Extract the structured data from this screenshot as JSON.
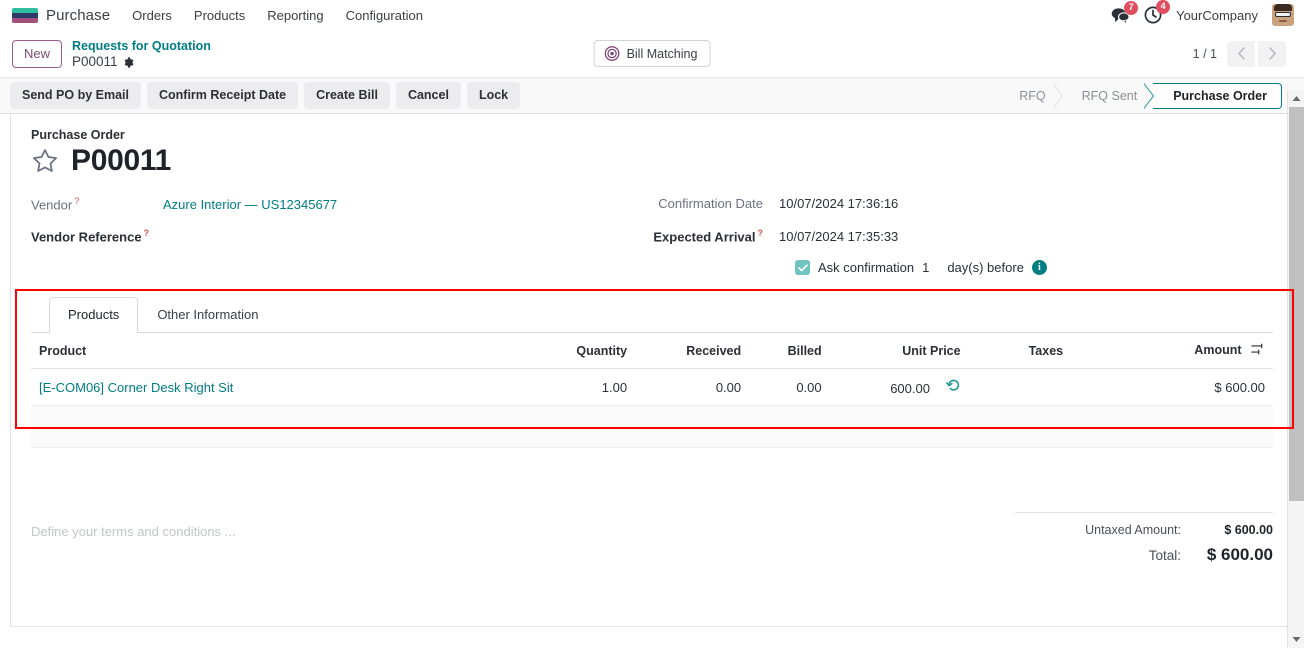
{
  "navbar": {
    "brand": "Purchase",
    "menus": [
      "Orders",
      "Products",
      "Reporting",
      "Configuration"
    ],
    "messages_badge": "7",
    "activities_badge": "4",
    "company": "YourCompany"
  },
  "control_panel": {
    "new_label": "New",
    "breadcrumb_parent": "Requests for Quotation",
    "breadcrumb_current": "P00011",
    "bill_matching_label": "Bill Matching",
    "pager": "1 / 1"
  },
  "actions": {
    "buttons": [
      "Send PO by Email",
      "Confirm Receipt Date",
      "Create Bill",
      "Cancel",
      "Lock"
    ]
  },
  "statusbar": {
    "stages": [
      "RFQ",
      "RFQ Sent",
      "Purchase Order"
    ],
    "active": "Purchase Order",
    "active_color": "#017e84"
  },
  "form": {
    "title_label": "Purchase Order",
    "record_name": "P00011",
    "vendor_label": "Vendor",
    "vendor_value": "Azure Interior — US12345677",
    "vendor_reference_label": "Vendor Reference",
    "vendor_reference_value": "",
    "confirmation_date_label": "Confirmation Date",
    "confirmation_date_value": "10/07/2024 17:36:16",
    "expected_arrival_label": "Expected Arrival",
    "expected_arrival_value": "10/07/2024 17:35:33",
    "ask_confirmation_label": "Ask confirmation",
    "ask_confirmation_days": "1",
    "ask_confirmation_suffix": "day(s) before",
    "checkbox_color": "#71c3c0"
  },
  "notebook": {
    "tabs": [
      "Products",
      "Other Information"
    ],
    "active_tab": "Products",
    "highlight_color": "#ff0000"
  },
  "lines_table": {
    "headers": [
      "Product",
      "Quantity",
      "Received",
      "Billed",
      "Unit Price",
      "Taxes",
      "Amount"
    ],
    "rows": [
      {
        "product": "[E-COM06] Corner Desk Right Sit",
        "quantity": "1.00",
        "received": "0.00",
        "billed": "0.00",
        "unit_price": "600.00",
        "taxes": "",
        "amount": "$ 600.00"
      }
    ]
  },
  "footer": {
    "terms_placeholder": "Define your terms and conditions ...",
    "untaxed_label": "Untaxed Amount:",
    "untaxed_value": "$ 600.00",
    "total_label": "Total:",
    "total_value": "$ 600.00"
  }
}
